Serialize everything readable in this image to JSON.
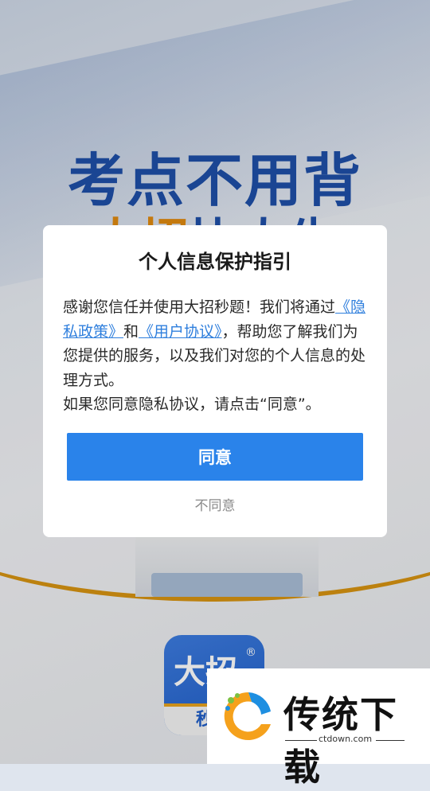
{
  "splash": {
    "slogan_line1": "考点不用背",
    "slogan_line2_accent": "大招",
    "slogan_line2_rest": "比人牛",
    "app_logo": {
      "main_char": "大招",
      "registered": "®",
      "sub": "秒题"
    }
  },
  "dialog": {
    "title": "个人信息保护指引",
    "body_part1": "感谢您信任并使用大招秒题！我们将通过",
    "privacy_link": "《隐私政策》",
    "body_and": "和",
    "user_agreement_link": "《用户协议》",
    "body_part2": "，帮助您了解我们为您提供的服务，以及我们对您的个人信息的处理方式。",
    "body_part3": "如果您同意隐私协议，请点击“同意”。",
    "agree_label": "同意",
    "disagree_label": "不同意"
  },
  "watermark": {
    "name": "传统下载",
    "url": "ctdown.com"
  },
  "colors": {
    "accent_blue": "#2a83ea",
    "link_blue": "#2f7fdd",
    "brand_orange": "#d69312"
  }
}
